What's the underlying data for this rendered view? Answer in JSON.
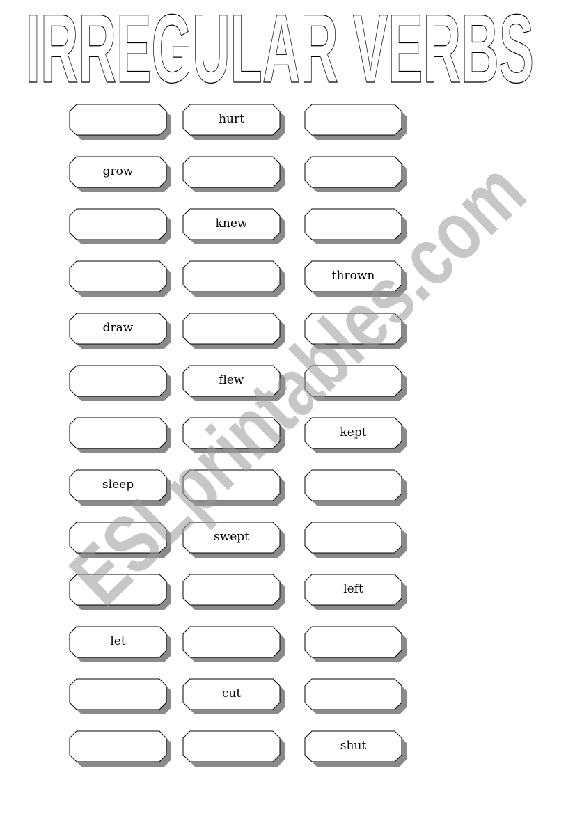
{
  "worksheet": {
    "title": "IRREGULAR VERBS",
    "watermark": "ESLprintables.com",
    "columns": 3,
    "rows": [
      [
        "",
        "hurt",
        ""
      ],
      [
        "grow",
        "",
        ""
      ],
      [
        "",
        "knew",
        ""
      ],
      [
        "",
        "",
        "thrown"
      ],
      [
        "draw",
        "",
        ""
      ],
      [
        "",
        "flew",
        ""
      ],
      [
        "",
        "",
        "kept"
      ],
      [
        "sleep",
        "",
        ""
      ],
      [
        "",
        "swept",
        ""
      ],
      [
        "",
        "",
        "left"
      ],
      [
        "let",
        "",
        ""
      ],
      [
        "",
        "cut",
        ""
      ],
      [
        "",
        "",
        "shut"
      ]
    ]
  }
}
